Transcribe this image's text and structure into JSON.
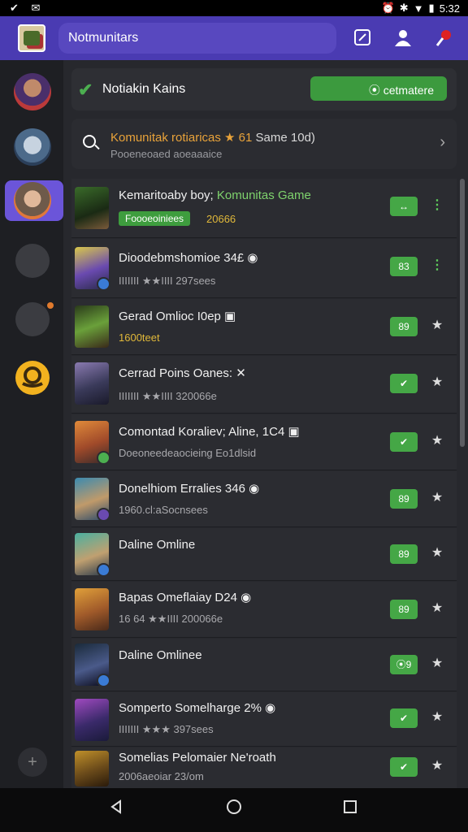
{
  "status": {
    "left_icons": "✔ ✉",
    "time": "5:32"
  },
  "appbar": {
    "title": "Notmunitars"
  },
  "notice": {
    "text": "Notiakin Kains",
    "button": "⦿ cetmatere"
  },
  "search": {
    "line1_orange": "Komunitak rotiaricas ★ 61",
    "line1_rest": " Same 10d)",
    "line2": "Pooeneoaed aoeaaaice"
  },
  "rows": [
    {
      "name": "Kemaritoaby boy; ",
      "name_green": "Komunitas Game",
      "tag": "Foooeoiniees",
      "sub": "20666",
      "pill": "↔",
      "trail": "⋮"
    },
    {
      "name": "Dioodebmshomioe 34£ ◉",
      "sub": "IIIIIII ★★IIII  297sees",
      "pill": "83",
      "trail": "⋮"
    },
    {
      "name": "Gerad Omlioc ⁠I0ep ▣",
      "sub": "1600teet",
      "pill": "89",
      "trail": "★"
    },
    {
      "name": "Cerrad Poins Oanes: ✕",
      "sub": "IIIIIII ★★IIII  320066e",
      "pill": "✔",
      "trail": "★"
    },
    {
      "name": "Comontad Koraliev; Aline, 1C4 ▣",
      "sub": "Doeoneedeaocieing   Eo1dlsid",
      "pill": "✔",
      "trail": "★"
    },
    {
      "name": "Donelhiom Erralies 346 ◉",
      "sub": "1960.cl:aSocnsees",
      "pill": "89",
      "trail": "★"
    },
    {
      "name": "Daline Omline",
      "sub": "",
      "pill": "89",
      "trail": "★"
    },
    {
      "name": "Bapas Omeflaiay D24 ◉",
      "sub": "16 64 ★★IIII  200066e",
      "pill": "89",
      "trail": "★"
    },
    {
      "name": "Daline Omlinee",
      "sub": "",
      "pill": "⦿9",
      "trail": "★"
    },
    {
      "name": "Somperto Somelharge 2% ◉",
      "sub": "IIIIIII ★★★  397sees",
      "pill": "✔",
      "trail": "★"
    },
    {
      "name": "Somelias Pelomaier Ne'roath",
      "sub": "2006aeoiar 23/om",
      "pill": "✔",
      "trail": "★"
    }
  ],
  "colors": {
    "accent": "#4a3bb2",
    "green": "#45a746",
    "bg": "#27282d"
  },
  "icons": [
    "check-icon",
    "search-icon",
    "chevron-right-icon",
    "star-icon",
    "more-icon",
    "back-icon",
    "home-icon",
    "recents-icon"
  ]
}
